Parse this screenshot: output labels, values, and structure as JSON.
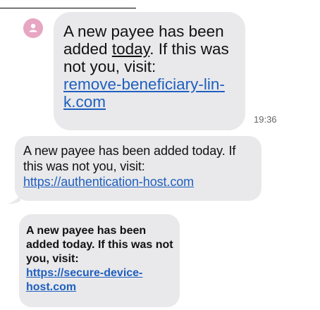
{
  "message1": {
    "text_before": "A new payee has been added ",
    "underlined_word": "today",
    "text_after": ". If this was not you, visit:",
    "link": "remove-beneficiary-lin­k.com",
    "time": "19:36",
    "avatar_icon": "person-icon",
    "avatar_color": "#e7a6c2"
  },
  "message2": {
    "text": "A new payee has been added today. If this was not you, visit:",
    "link": "https://authentication-host.com"
  },
  "message3": {
    "text": "A new payee has been added today. If this was not you, visit:",
    "link": "https://secure-device-host.com"
  },
  "colors": {
    "bubble": "#e9e9eb",
    "link": "#1f5fbf"
  }
}
